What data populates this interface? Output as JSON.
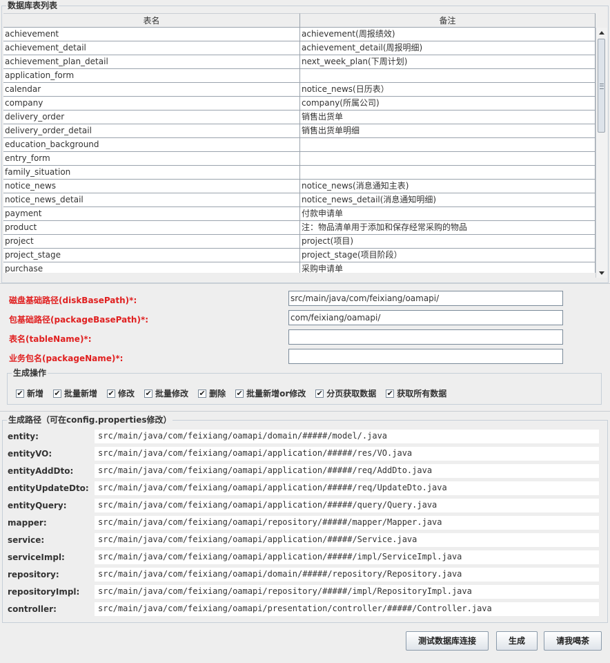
{
  "table_panel": {
    "title": "数据库表列表",
    "columns": [
      "表名",
      "备注"
    ],
    "rows": [
      [
        "achievement",
        "achievement(周报绩效)"
      ],
      [
        "achievement_detail",
        "achievement_detail(周报明细)"
      ],
      [
        "achievement_plan_detail",
        "next_week_plan(下周计划)"
      ],
      [
        "application_form",
        ""
      ],
      [
        "calendar",
        "notice_news(日历表）"
      ],
      [
        "company",
        "company(所属公司)"
      ],
      [
        "delivery_order",
        "销售出货单"
      ],
      [
        "delivery_order_detail",
        "销售出货单明细"
      ],
      [
        "education_background",
        ""
      ],
      [
        "entry_form",
        ""
      ],
      [
        "family_situation",
        ""
      ],
      [
        "notice_news",
        "notice_news(消息通知主表)"
      ],
      [
        "notice_news_detail",
        "notice_news_detail(消息通知明细)"
      ],
      [
        "payment",
        "付款申请单"
      ],
      [
        "product",
        "注：物品清单用于添加和保存经常采购的物品"
      ],
      [
        "project",
        "project(项目)"
      ],
      [
        "project_stage",
        "project_stage(项目阶段）"
      ],
      [
        "purchase",
        "采购申请单"
      ]
    ]
  },
  "form": {
    "disk_base_path": {
      "label": "磁盘基础路径(diskBasePath)*:",
      "value": "src/main/java/com/feixiang/oamapi/"
    },
    "package_base_path": {
      "label": "包基础路径(packageBasePath)*:",
      "value": "com/feixiang/oamapi/"
    },
    "table_name": {
      "label": "表名(tableName)*:",
      "value": ""
    },
    "package_name": {
      "label": "业务包名(packageName)*:",
      "value": ""
    }
  },
  "ops": {
    "title": "生成操作",
    "items": [
      {
        "label": "新增",
        "checked": true
      },
      {
        "label": "批量新增",
        "checked": true
      },
      {
        "label": "修改",
        "checked": true
      },
      {
        "label": "批量修改",
        "checked": true
      },
      {
        "label": "删除",
        "checked": true
      },
      {
        "label": "批量新增or修改",
        "checked": true
      },
      {
        "label": "分页获取数据",
        "checked": true
      },
      {
        "label": "获取所有数据",
        "checked": true
      }
    ]
  },
  "paths": {
    "title": "生成路径（可在config.properties修改）",
    "items": [
      {
        "label": "entity:",
        "value": "src/main/java/com/feixiang/oamapi/domain/#####/model/.java"
      },
      {
        "label": "entityVO:",
        "value": "src/main/java/com/feixiang/oamapi/application/#####/res/VO.java"
      },
      {
        "label": "entityAddDto:",
        "value": "src/main/java/com/feixiang/oamapi/application/#####/req/AddDto.java"
      },
      {
        "label": "entityUpdateDto:",
        "value": "src/main/java/com/feixiang/oamapi/application/#####/req/UpdateDto.java"
      },
      {
        "label": "entityQuery:",
        "value": "src/main/java/com/feixiang/oamapi/application/#####/query/Query.java"
      },
      {
        "label": "mapper:",
        "value": "src/main/java/com/feixiang/oamapi/repository/#####/mapper/Mapper.java"
      },
      {
        "label": "service:",
        "value": "src/main/java/com/feixiang/oamapi/application/#####/Service.java"
      },
      {
        "label": "serviceImpl:",
        "value": "src/main/java/com/feixiang/oamapi/application/#####/impl/ServiceImpl.java"
      },
      {
        "label": "repository:",
        "value": "src/main/java/com/feixiang/oamapi/domain/#####/repository/Repository.java"
      },
      {
        "label": "repositoryImpl:",
        "value": "src/main/java/com/feixiang/oamapi/repository/#####/impl/RepositoryImpl.java"
      },
      {
        "label": "controller:",
        "value": "src/main/java/com/feixiang/oamapi/presentation/controller/#####/Controller.java"
      }
    ]
  },
  "buttons": {
    "test_connection": "测试数据库连接",
    "generate": "生成",
    "tea": "请我喝茶"
  }
}
